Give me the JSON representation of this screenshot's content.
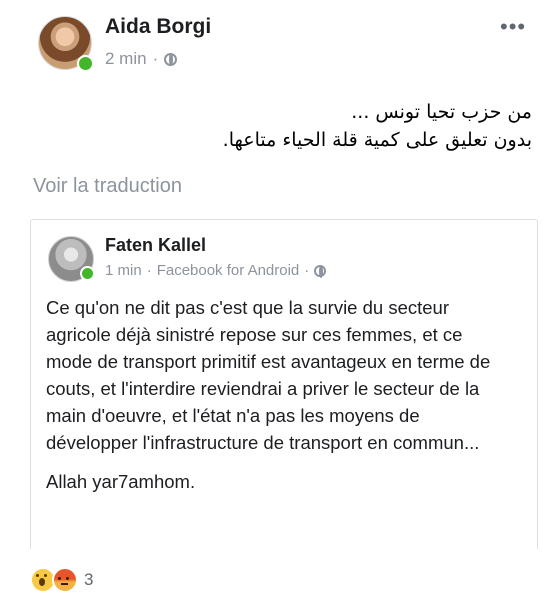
{
  "post": {
    "author": "Aida Borgi",
    "time": "2 min",
    "separator": "·",
    "menu_glyph": "•••",
    "privacy_icon": "globe-icon",
    "text_line1": "من حزب تحيا تونس ...",
    "text_line2": "بدون تعليق على كمية قلة الحياء متاعها.",
    "translate_label": "Voir la traduction"
  },
  "shared": {
    "author": "Faten Kallel",
    "time": "1 min",
    "separator1": "·",
    "source": "Facebook for Android",
    "separator2": "·",
    "privacy_icon": "globe-icon",
    "paragraph1": "Ce qu'on ne dit pas c'est que la survie du secteur agricole déjà sinistré repose sur ces femmes, et ce mode de transport primitif est avantageux en terme de couts, et l'interdire reviendrai a priver le secteur de la main d'oeuvre, et l'état n'a pas les moyens de développer l'infrastructure de transport en commun...",
    "paragraph2": "Allah yar7amhom."
  },
  "reactions": {
    "icons": [
      "wow-reaction-icon",
      "angry-reaction-icon"
    ],
    "count": "3"
  },
  "colors": {
    "secondary_text": "#8d949e",
    "online": "#42b72a",
    "border": "#dddfe2"
  }
}
